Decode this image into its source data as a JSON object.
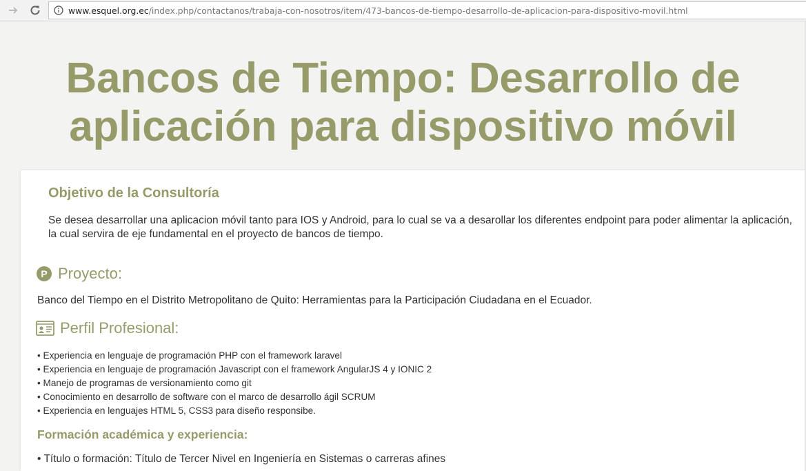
{
  "browser": {
    "url_domain": "www.esquel.org.ec",
    "url_path": "/index.php/contactanos/trabaja-con-nosotros/item/473-bancos-de-tiempo-desarrollo-de-aplicacion-para-dispositivo-movil.html"
  },
  "hero": {
    "title_line1": "Bancos de Tiempo: Desarrollo de",
    "title_line2": "aplicación para dispositivo móvil"
  },
  "objetivo": {
    "heading": "Objetivo de la Consultoría",
    "text": "Se desea desarrollar una aplicacion móvil tanto para IOS y Android, para lo cual se va a desarollar los diferentes endpoint para poder alimentar la aplicación, la cual servira de eje fundamental en el proyecto de bancos de tiempo."
  },
  "proyecto": {
    "heading": "Proyecto:",
    "text": "Banco del Tiempo en el Distrito Metropolitano de Quito: Herramientas para la Participación Ciudadana en el Ecuador."
  },
  "perfil": {
    "heading": "Perfil Profesional:",
    "items": [
      "• Experiencia en lenguaje de programación PHP con el framework laravel",
      "• Experiencia en lenguaje de programación Javascript con el framework AngularJS 4 y IONIC 2",
      "• Manejo de programas de versionamiento como git",
      "• Conocimiento en desarrollo de software con el marco de desarrollo ágil SCRUM",
      "• Experiencia en lenguajes HTML 5, CSS3 para diseño responsibe."
    ]
  },
  "formacion": {
    "heading": "Formación académica y experiencia:",
    "text": "• Título o formación: Título de Tercer Nivel en Ingeniería en Sistemas o carreras afines"
  },
  "icons": {
    "forward": "arrow-forward-icon",
    "reload": "reload-icon",
    "info": "info-icon",
    "proyecto": "p-circle-icon",
    "perfil": "id-card-icon"
  },
  "colors": {
    "accent": "#979b6a",
    "page_bg": "#f3f3f1",
    "card_bg": "#ffffff",
    "text": "#333333"
  }
}
